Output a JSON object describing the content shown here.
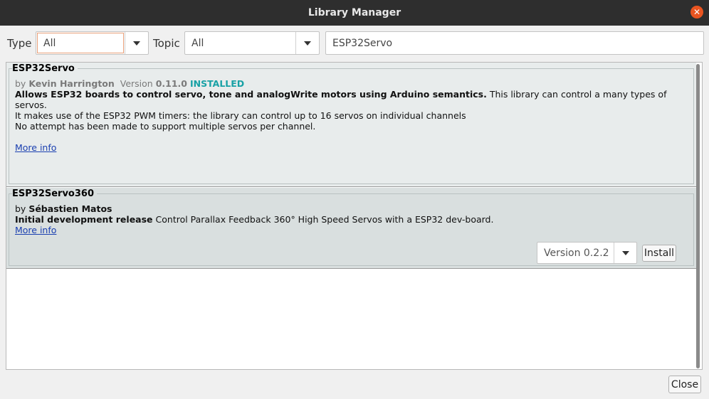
{
  "window": {
    "title": "Library Manager"
  },
  "filters": {
    "type_label": "Type",
    "type_value": "All",
    "topic_label": "Topic",
    "topic_value": "All",
    "search_value": "ESP32Servo"
  },
  "libraries": [
    {
      "name": "ESP32Servo",
      "by": "by",
      "author": "Kevin Harrington",
      "version_label": "Version",
      "version": "0.11.0",
      "status": "INSTALLED",
      "summary": "Allows ESP32 boards to control servo, tone and analogWrite motors using Arduino semantics.",
      "description_1": "This library can control a many types of",
      "description_2": "servos.",
      "description_3": "It makes use of the ESP32 PWM timers: the library can control up to 16 servos on individual channels",
      "description_4": "No attempt has been made to support multiple servos per channel.",
      "more_info": "More info"
    },
    {
      "name": "ESP32Servo360",
      "by": "by",
      "author": "Sébastien Matos",
      "summary": "Initial development release",
      "description": "Control Parallax Feedback 360° High Speed Servos with a ESP32 dev-board.",
      "more_info": "More info",
      "version_select": "Version 0.2.2",
      "install_label": "Install"
    }
  ],
  "footer": {
    "close_label": "Close"
  }
}
